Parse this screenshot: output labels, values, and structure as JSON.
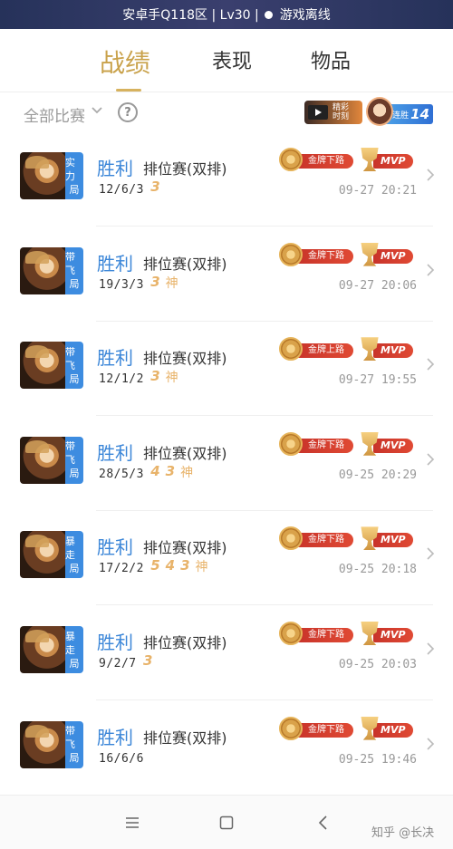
{
  "status_bar": {
    "left": "安卓手Q118区 | Lv30 |",
    "right": "游戏离线"
  },
  "tabs": [
    {
      "label": "战绩",
      "active": true
    },
    {
      "label": "表现",
      "active": false
    },
    {
      "label": "物品",
      "active": false
    }
  ],
  "filter": {
    "label": "全部比赛",
    "help_icon": "question-circle-icon"
  },
  "highlight": {
    "icon": "video-icon",
    "label_line1": "精彩",
    "label_line2": "时刻"
  },
  "streak": {
    "label": "连胜",
    "count": "14"
  },
  "matches": [
    {
      "tag_line1": "实力",
      "tag_line2": "局",
      "result": "胜利",
      "mode": "排位赛(双排)",
      "kda": "12/6/3",
      "badges": [
        "3"
      ],
      "honor": "金牌下路",
      "mvp": "MVP",
      "time": "09-27 20:21"
    },
    {
      "tag_line1": "带飞",
      "tag_line2": "局",
      "result": "胜利",
      "mode": "排位赛(双排)",
      "kda": "19/3/3",
      "badges": [
        "3",
        "神"
      ],
      "honor": "金牌下路",
      "mvp": "MVP",
      "time": "09-27 20:06"
    },
    {
      "tag_line1": "带飞",
      "tag_line2": "局",
      "result": "胜利",
      "mode": "排位赛(双排)",
      "kda": "12/1/2",
      "badges": [
        "3",
        "神"
      ],
      "honor": "金牌上路",
      "mvp": "MVP",
      "time": "09-27 19:55"
    },
    {
      "tag_line1": "带飞",
      "tag_line2": "局",
      "result": "胜利",
      "mode": "排位赛(双排)",
      "kda": "28/5/3",
      "badges": [
        "4",
        "3",
        "神"
      ],
      "honor": "金牌下路",
      "mvp": "MVP",
      "time": "09-25 20:29"
    },
    {
      "tag_line1": "暴走",
      "tag_line2": "局",
      "result": "胜利",
      "mode": "排位赛(双排)",
      "kda": "17/2/2",
      "badges": [
        "5",
        "4",
        "3",
        "神"
      ],
      "honor": "金牌下路",
      "mvp": "MVP",
      "time": "09-25 20:18"
    },
    {
      "tag_line1": "暴走",
      "tag_line2": "局",
      "result": "胜利",
      "mode": "排位赛(双排)",
      "kda": "9/2/7",
      "badges": [
        "3"
      ],
      "honor": "金牌下路",
      "mvp": "MVP",
      "time": "09-25 20:03"
    },
    {
      "tag_line1": "带飞",
      "tag_line2": "局",
      "result": "胜利",
      "mode": "排位赛(双排)",
      "kda": "16/6/6",
      "badges": [],
      "honor": "金牌下路",
      "mvp": "MVP",
      "time": "09-25 19:46"
    }
  ],
  "watermark": "知乎 @长决"
}
